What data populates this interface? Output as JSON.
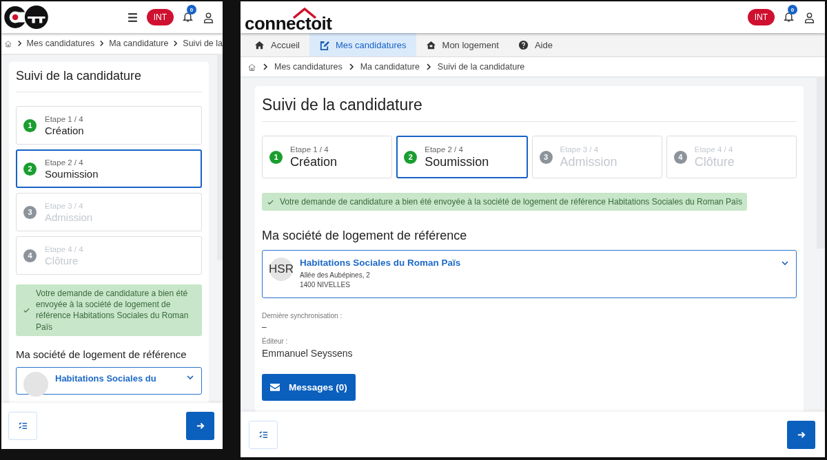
{
  "mobile": {
    "env_badge": "INT",
    "notification_count": "0",
    "breadcrumb": [
      "Mes candidatures",
      "Ma candidature",
      "Suivi de la"
    ],
    "title": "Suivi de la candidature",
    "steps": [
      {
        "number": "1",
        "label": "Etape 1 / 4",
        "name": "Création",
        "enabled": true,
        "selected": false
      },
      {
        "number": "2",
        "label": "Etape 2 / 4",
        "name": "Soumission",
        "enabled": true,
        "selected": true
      },
      {
        "number": "3",
        "label": "Etape 3 / 4",
        "name": "Admission",
        "enabled": false,
        "selected": false
      },
      {
        "number": "4",
        "label": "Etape 4 / 4",
        "name": "Clôture",
        "enabled": false,
        "selected": false
      }
    ],
    "alert": "Votre demande de candidature a bien été envoyée à la société de logement de référence Habitations Sociales du Roman Païs",
    "section_title": "Ma société de logement de référence",
    "company": {
      "name": "Habitations Sociales du"
    }
  },
  "desktop": {
    "logo_text": "connectoit",
    "env_badge": "INT",
    "notification_count": "0",
    "nav": [
      {
        "label": "Accueil",
        "selected": false
      },
      {
        "label": "Mes candidatures",
        "selected": true
      },
      {
        "label": "Mon logement",
        "selected": false
      },
      {
        "label": "Aide",
        "selected": false
      }
    ],
    "breadcrumb": [
      "Mes candidatures",
      "Ma candidature",
      "Suivi de la candidature"
    ],
    "title": "Suivi de la candidature",
    "steps": [
      {
        "number": "1",
        "label": "Etape 1 / 4",
        "name": "Création",
        "enabled": true,
        "selected": false
      },
      {
        "number": "2",
        "label": "Etape 2 / 4",
        "name": "Soumission",
        "enabled": true,
        "selected": true
      },
      {
        "number": "3",
        "label": "Etape 3 / 4",
        "name": "Admission",
        "enabled": false,
        "selected": false
      },
      {
        "number": "4",
        "label": "Etape 4 / 4",
        "name": "Clôture",
        "enabled": false,
        "selected": false
      }
    ],
    "alert": "Votre demande de candidature a bien été envoyée à la société de logement de référence Habitations Sociales du Roman Païs",
    "section_title": "Ma société de logement de référence",
    "company": {
      "initials": "HSR",
      "name": "Habitations Sociales du Roman Païs",
      "address_line_1": "Allée des Aubépines, 2",
      "address_line_2": "1400 NIVELLES"
    },
    "fields": [
      {
        "label": "Dernière synchronisation :",
        "value": "–"
      },
      {
        "label": "Éditeur :",
        "value": "Emmanuel Seyssens"
      }
    ],
    "messages_button": "Messages (0)"
  }
}
